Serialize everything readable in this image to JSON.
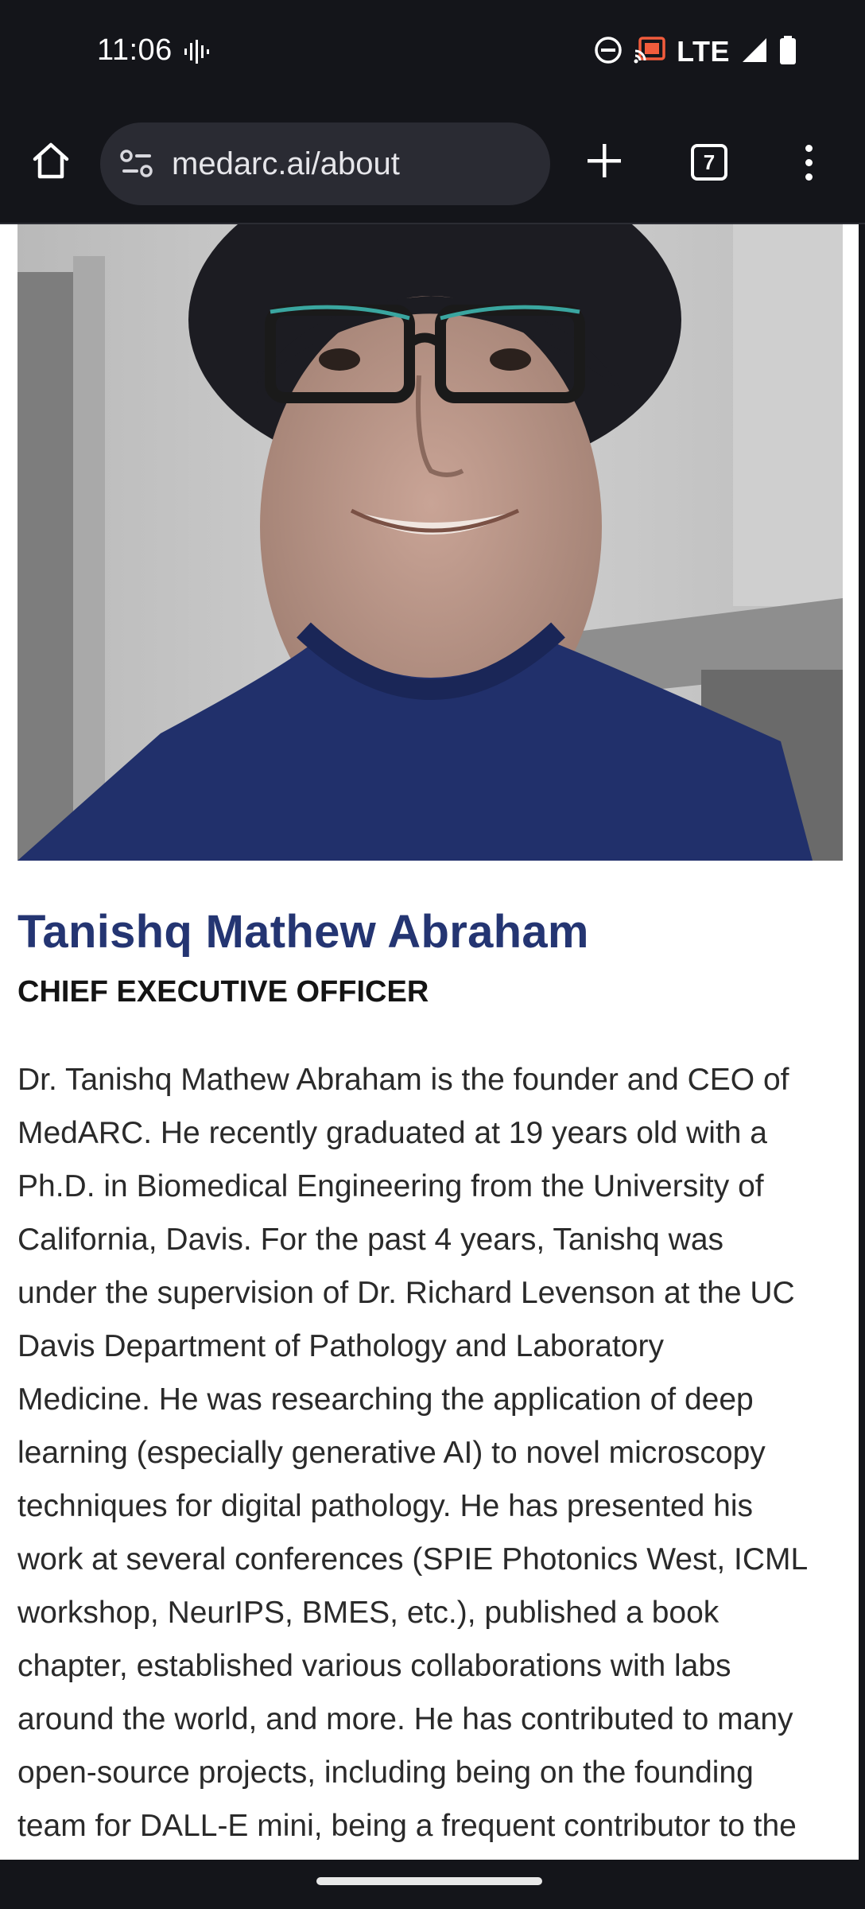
{
  "status_bar": {
    "time": "11:06",
    "network": "LTE",
    "icons": [
      "sound-wave-icon",
      "do-not-disturb-icon",
      "cast-icon",
      "signal-icon",
      "battery-icon"
    ]
  },
  "browser": {
    "url": "medarc.ai/about",
    "tab_count": "7",
    "icons": [
      "home-icon",
      "site-info-icon",
      "plus-icon",
      "tabs-icon",
      "more-vert-icon"
    ]
  },
  "profile": {
    "name": "Tanishq Mathew Abraham",
    "role": "CHIEF EXECUTIVE OFFICER",
    "bio_lines": [
      "Dr. Tanishq Mathew Abraham is the founder and CEO of",
      "MedARC. He recently graduated at 19 years old with a",
      "Ph.D. in Biomedical Engineering from the University of",
      "California, Davis. For the past 4 years, Tanishq was",
      "under the supervision of Dr. Richard Levenson at the UC",
      "Davis Department of Pathology and Laboratory",
      "Medicine. He was researching the application of deep",
      "learning (especially generative AI) to novel microscopy",
      "techniques for digital pathology. He has presented his",
      "work at several conferences (SPIE Photonics West, ICML",
      "workshop, NeurIPS, BMES, etc.), published a book",
      "chapter, established various collaborations with labs",
      "around the world, and more. He has contributed to many",
      "open-source projects, including being on the founding",
      "team for DALL-E mini, being a frequent contributor to the"
    ]
  },
  "colors": {
    "name_color": "#243572",
    "browser_bg": "#14151a",
    "omnibox_bg": "#2a2b33"
  }
}
